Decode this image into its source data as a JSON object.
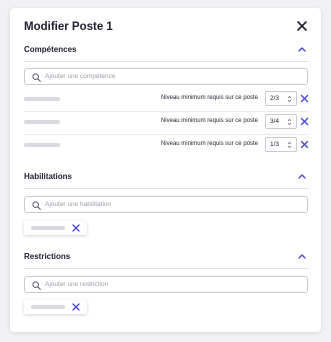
{
  "modal": {
    "title": "Modifier Poste 1",
    "close_icon": "close-icon"
  },
  "colors": {
    "accent": "#4b45d6",
    "placeholder_bar": "#d8d8de",
    "text": "#1e1e2d"
  },
  "competences": {
    "title": "Compétences",
    "search_placeholder": "Ajouter une compétence",
    "rows": [
      {
        "label": "Niveau minimum requis sur ce poste",
        "level": "2/3"
      },
      {
        "label": "Niveau minimum requis sur ce poste",
        "level": "3/4"
      },
      {
        "label": "Niveau minimum requis sur ce poste",
        "level": "1/3"
      }
    ]
  },
  "habilitations": {
    "title": "Habilitations",
    "search_placeholder": "Ajouter une habilitation"
  },
  "restrictions": {
    "title": "Restrictions",
    "search_placeholder": "Ajouter une restriction"
  }
}
